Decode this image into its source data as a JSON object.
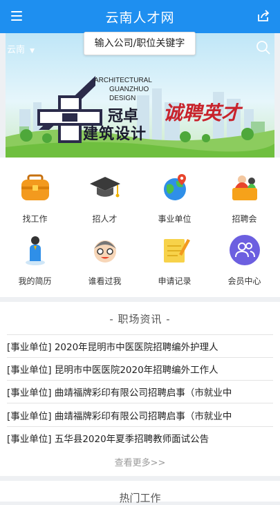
{
  "header": {
    "title": "云南人才网"
  },
  "location": {
    "label": "云南"
  },
  "search": {
    "placeholder": "输入公司/职位关键字"
  },
  "banner": {
    "company_en_1": "ARCHITECTURAL",
    "company_en_2": "GUANZHUO",
    "company_en_3": "DESIGN",
    "company_cn_1": "冠卓",
    "company_cn_2": "建筑设计",
    "slogan": "诚聘英才"
  },
  "grid": {
    "items": [
      {
        "label": "找工作",
        "icon": "briefcase-icon"
      },
      {
        "label": "招人才",
        "icon": "graduation-cap-icon"
      },
      {
        "label": "事业单位",
        "icon": "globe-icon"
      },
      {
        "label": "招聘会",
        "icon": "job-fair-icon"
      },
      {
        "label": "我的简历",
        "icon": "person-icon"
      },
      {
        "label": "谁看过我",
        "icon": "viewer-face-icon"
      },
      {
        "label": "申请记录",
        "icon": "notepad-icon"
      },
      {
        "label": "会员中心",
        "icon": "members-icon"
      }
    ]
  },
  "news": {
    "heading": "- 职场资讯 -",
    "items": [
      "[事业单位] 2020年昆明市中医医院招聘编外护理人",
      "[事业单位] 昆明市中医医院2020年招聘编外工作人",
      "[事业单位] 曲靖福牌彩印有限公司招聘启事（市就业中",
      "[事业单位] 曲靖福牌彩印有限公司招聘启事（市就业中",
      "[事业单位] 五华县2020年夏季招聘教师面试公告"
    ],
    "more": "查看更多>>"
  },
  "next_section": {
    "heading": "热门工作"
  },
  "colors": {
    "primary": "#1e8ff0"
  }
}
